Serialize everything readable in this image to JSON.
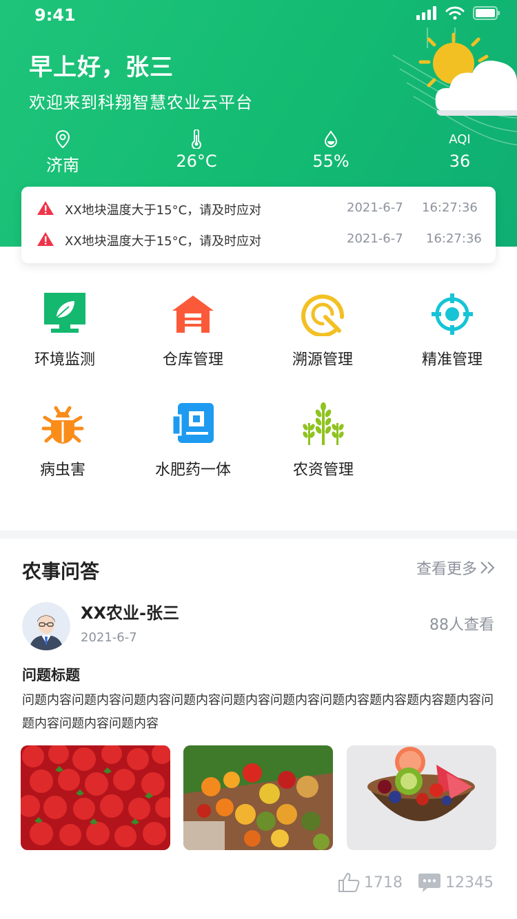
{
  "status_bar": {
    "time": "9:41"
  },
  "header": {
    "greeting": "早上好，张三",
    "welcome": "欢迎来到科翔智慧农业云平台",
    "stats": {
      "location": "济南",
      "temperature": "26°C",
      "humidity": "55%",
      "aqi_label": "AQI",
      "aqi_value": "36"
    }
  },
  "alerts": [
    {
      "message": "XX地块温度大于15°C，请及时应对",
      "date": "2021-6-7",
      "time": "16:27:36"
    },
    {
      "message": "XX地块温度大于15°C，请及时应对",
      "date": "2021-6-7",
      "time": "16:27:36"
    }
  ],
  "functions": [
    {
      "label": "环境监测",
      "icon": "monitor-leaf-icon"
    },
    {
      "label": "仓库管理",
      "icon": "warehouse-icon"
    },
    {
      "label": "溯源管理",
      "icon": "trace-icon"
    },
    {
      "label": "精准管理",
      "icon": "target-icon"
    },
    {
      "label": "病虫害",
      "icon": "bug-icon"
    },
    {
      "label": "水肥药一体",
      "icon": "fertigation-icon"
    },
    {
      "label": "农资管理",
      "icon": "crop-icon"
    }
  ],
  "qa": {
    "section_title": "农事问答",
    "more_label": "查看更多",
    "post": {
      "author": "XX农业-张三",
      "date": "2021-6-7",
      "views": "88人查看",
      "title": "问题标题",
      "content": "问题内容问题内容问题内容问题内容问题内容问题内容问题内容题内容题内容题内容问题内容问题内容问题内容",
      "likes": "1718",
      "comments": "12345"
    }
  },
  "colors": {
    "brand_green": "#13bb72",
    "alert_red": "#f0344a",
    "muted": "#8d939c"
  }
}
